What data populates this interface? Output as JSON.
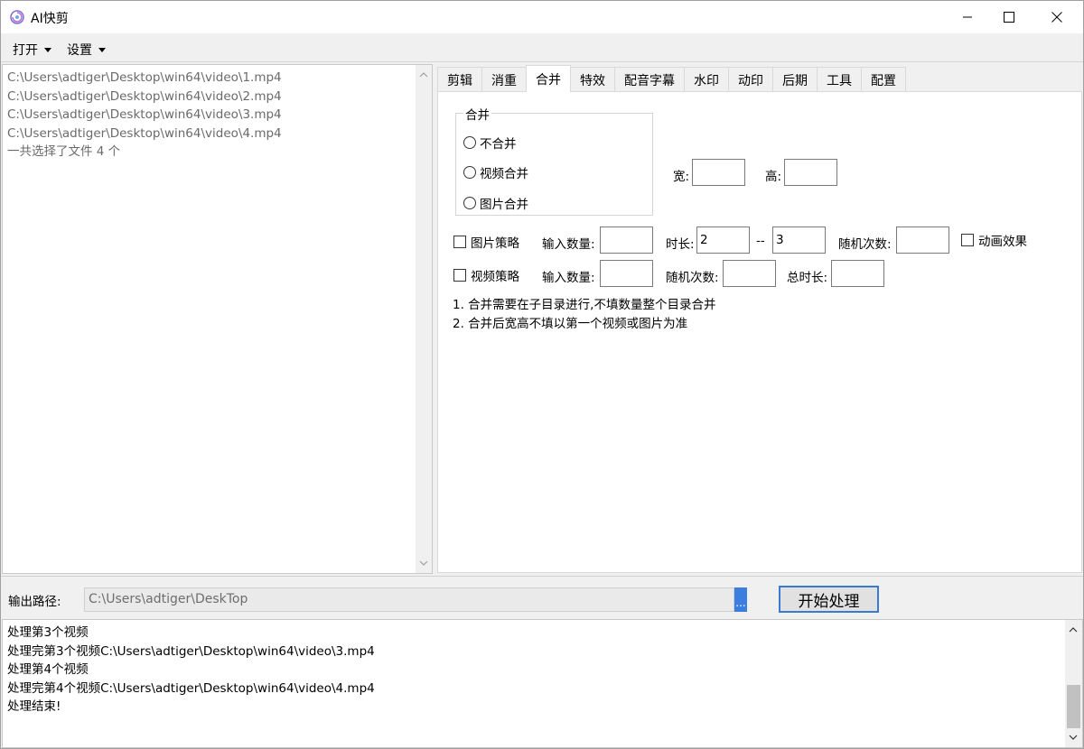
{
  "window": {
    "title": "AI快剪",
    "icon": "app-spiral-icon"
  },
  "menu": {
    "open_label": "打开",
    "settings_label": "设置"
  },
  "file_list": {
    "items": [
      "C:\\Users\\adtiger\\Desktop\\win64\\video\\1.mp4",
      "C:\\Users\\adtiger\\Desktop\\win64\\video\\2.mp4",
      "C:\\Users\\adtiger\\Desktop\\win64\\video\\3.mp4",
      "C:\\Users\\adtiger\\Desktop\\win64\\video\\4.mp4"
    ],
    "summary": "一共选择了文件 4 个"
  },
  "tabs": [
    "剪辑",
    "消重",
    "合并",
    "特效",
    "配音字幕",
    "水印",
    "动印",
    "后期",
    "工具",
    "配置"
  ],
  "active_tab": "合并",
  "merge": {
    "group_title": "合并",
    "radio_none": "不合并",
    "radio_video": "视频合并",
    "radio_image": "图片合并",
    "width_label": "宽:",
    "height_label": "高:",
    "image_strategy": {
      "label": "图片策略",
      "count_label": "输入数量:",
      "duration_label": "时长:",
      "duration_min": "2",
      "duration_sep": "--",
      "duration_max": "3",
      "random_label": "随机次数:",
      "anim_label": "动画效果"
    },
    "video_strategy": {
      "label": "视频策略",
      "count_label": "输入数量:",
      "random_label": "随机次数:",
      "total_label": "总时长:"
    },
    "notes": [
      "1. 合并需要在子目录进行,不填数量整个目录合并",
      "2. 合并后宽高不填以第一个视频或图片为准"
    ]
  },
  "output": {
    "label": "输出路径:",
    "path": "C:\\Users\\adtiger\\DeskTop",
    "browse_label": "...",
    "start_label": "开始处理"
  },
  "log": {
    "lines": [
      "处理第3个视频",
      "处理完第3个视频C:\\Users\\adtiger\\Desktop\\win64\\video\\3.mp4",
      "处理第4个视频",
      "处理完第4个视频C:\\Users\\adtiger\\Desktop\\win64\\video\\4.mp4",
      "处理结束!"
    ]
  },
  "colors": {
    "accent": "#3c7ee0",
    "panel_bg": "#f0f0f0"
  }
}
